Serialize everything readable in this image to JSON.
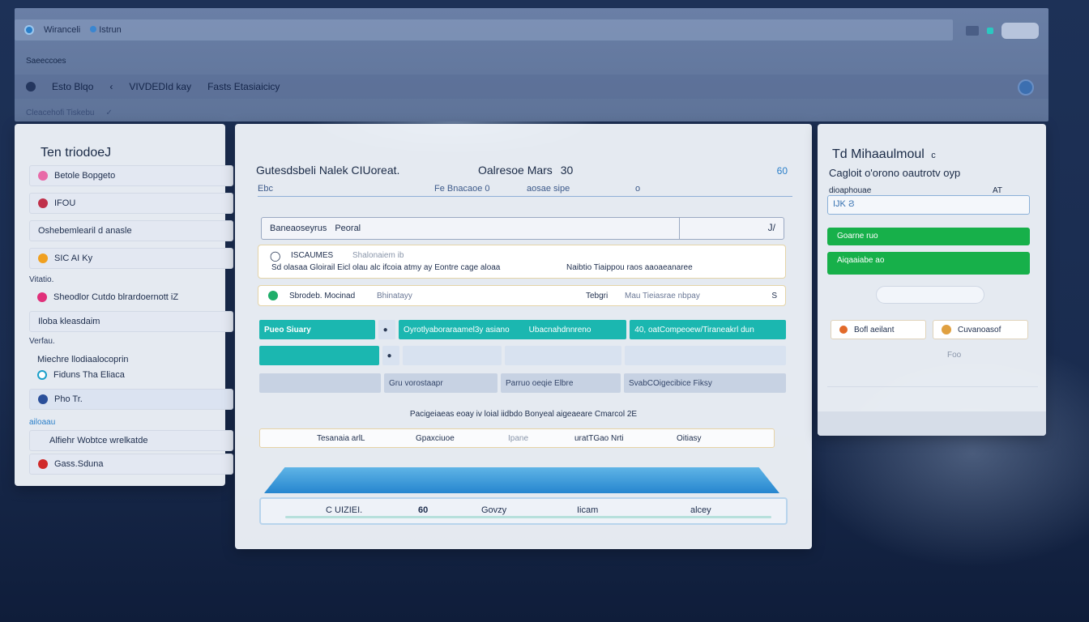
{
  "window": {
    "tab1": "Wiranceli",
    "tab2": "Istrun",
    "subnav": "Saeeccoes",
    "crumbs": [
      "Esto Blqo",
      "VIVDEDId kay",
      "Fasts Etasiaicicy"
    ],
    "toolbar": [
      "Cleacehofi Tiskebu",
      "✓"
    ]
  },
  "left": {
    "title": "Ten triodoeJ",
    "items": [
      "Betole Bopgeto",
      "IFOU",
      "Oshebemlearil d anasle",
      "SIC AI Ky",
      "Sheodlor Cutdo blrardoernott iZ",
      "Iloba kleasdaim",
      "Miechre llodiaalocoprin",
      "Fiduns Tha Eliaca",
      "Pho Tr.",
      "Alfiehr Wobtce wrelkatde",
      "Gass.Sduna"
    ],
    "sections": [
      "Vitatio.",
      "Verfau.",
      "ailoaau"
    ]
  },
  "center": {
    "heading": "Gutesdsbeli Nalek CIUoreat.",
    "heading2": "Oalresoe Mars",
    "heading2_num": "30",
    "corner_num": "60",
    "sub_left": "Ebc",
    "sub_mid": "Fe Bnacaoe 0",
    "sub_right": "aosae sipe",
    "sub_end": "o",
    "search_label": "Baneaoseyrus",
    "search_value": "Peoral",
    "search_chev": "J/",
    "card1_title": "ISCAUMES",
    "card1_title2": "Shalonaiem ib",
    "card1_body": "Sd olasaa Gloirail   Eicl olau alc ifcoia atmy ay Eontre cage aloaa",
    "card1_body2": "Naibtio Tiaippou   raos aaoaeanaree",
    "card2_label": "Sbrodeb. Mocinad",
    "card2_mid": "Bhinatayy",
    "card2_right": "Tebgri",
    "card2_right2": "Mau Tieiasrae nbpay",
    "card2_end": "S",
    "row1": [
      "Pueo Siuary",
      "Oyrotlyaboraraamel3y asiano",
      "Ubacnahdnnreno",
      "40, oatCompeoew/Tiraneakrl dun"
    ],
    "row3": [
      "Gru vorostaapr",
      "Parruo oeqie Elbre",
      "SvabCOigecibice Fiksy"
    ],
    "caption": "Pacigeiaeas eoay iv loial iidbdo Bonyeal aigeaeare Cmarcol 2E",
    "actions": [
      "Tesanaia arlL",
      "Gpaxciuoe",
      "Ipane",
      "uratTGao Nrti",
      "Oitiasy"
    ],
    "footer": [
      "C UIZIEI.",
      "60",
      "Govzy",
      "Iicam",
      "alcey"
    ]
  },
  "right": {
    "title": "Td Mihaaulmoul",
    "title_suffix": "c",
    "subtitle": "Cagloit o'orono oautrotv oyp",
    "label": "dioaphouae",
    "count": "AT",
    "input_value": "IJK Ϩ",
    "btn1": "Goarne ruo",
    "btn2": "Aiqaaiabe ao",
    "chip1": "Bofl aeilant",
    "chip2": "Cuvanoasof",
    "note": "Foo"
  },
  "colors": {
    "teal": "#1bb7b0",
    "green": "#17b04a",
    "blue": "#2686cf",
    "navy_bg": "#1d3157"
  }
}
